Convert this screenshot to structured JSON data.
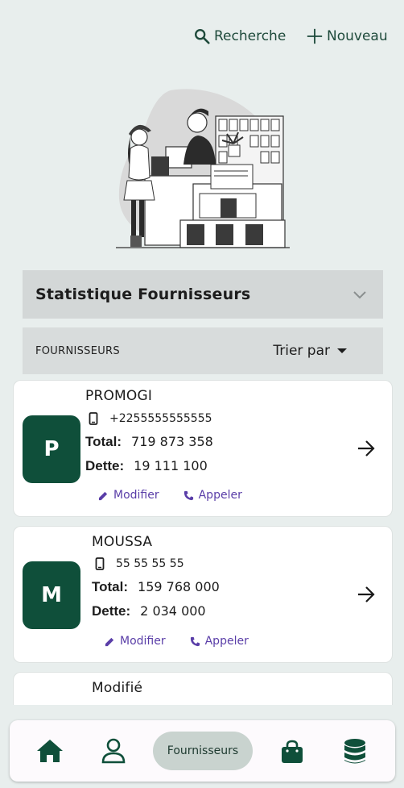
{
  "header": {
    "search_label": "Recherche",
    "new_label": "Nouveau"
  },
  "stats": {
    "title": "Statistique Fournisseurs"
  },
  "filter": {
    "label": "FOURNISSEURS",
    "sort_label": "Trier par"
  },
  "suppliers": [
    {
      "initial": "P",
      "name": "PROMOGI",
      "phone": "+2255555555555",
      "total_label": "Total:",
      "total": "719 873 358",
      "debt_label": "Dette:",
      "debt": "19 111 100",
      "edit_label": "Modifier",
      "call_label": "Appeler"
    },
    {
      "initial": "M",
      "name": "MOUSSA",
      "phone": "55 55 55 55",
      "total_label": "Total:",
      "total": "159 768 000",
      "debt_label": "Dette:",
      "debt": "2 034 000",
      "edit_label": "Modifier",
      "call_label": "Appeler"
    },
    {
      "name": "Modifié"
    }
  ],
  "nav": {
    "active_label": "Fournisseurs",
    "items": [
      "home-icon",
      "person-icon",
      "bag-icon",
      "database-icon"
    ]
  },
  "colors": {
    "brand": "#0f4f3a",
    "accent_link": "#5a3ea8",
    "background": "#e8eeed"
  }
}
